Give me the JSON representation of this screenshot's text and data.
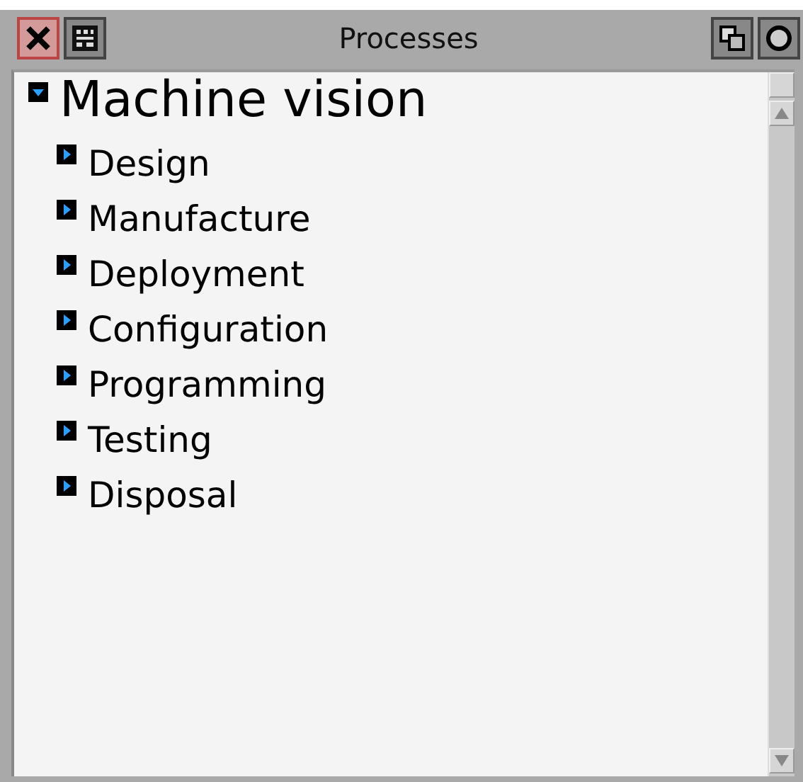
{
  "window": {
    "title": "Processes"
  },
  "tree": [
    {
      "label": "Machine vision",
      "expanded": true,
      "children": [
        {
          "label": "Design",
          "expanded": false
        },
        {
          "label": "Manufacture",
          "expanded": false
        },
        {
          "label": "Deployment",
          "expanded": false
        },
        {
          "label": "Configuration",
          "expanded": false
        },
        {
          "label": "Programming",
          "expanded": false
        },
        {
          "label": "Testing",
          "expanded": false
        },
        {
          "label": "Disposal",
          "expanded": false
        }
      ]
    }
  ]
}
